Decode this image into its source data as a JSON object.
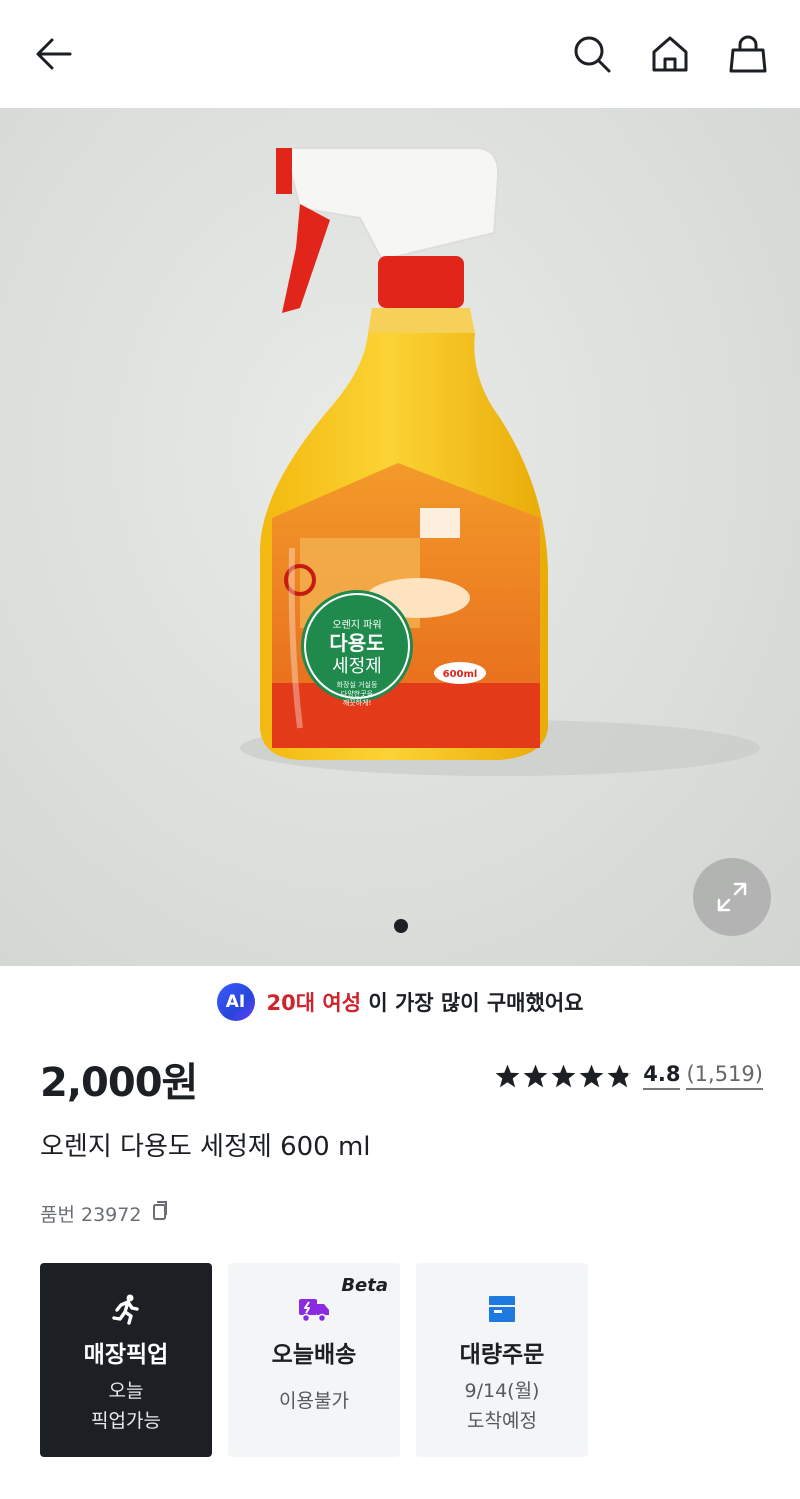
{
  "header": {
    "icons": [
      "arrow-left-icon",
      "search-icon",
      "home-icon",
      "shopping-bag-icon"
    ]
  },
  "gallery": {
    "label": {
      "line1": "오렌지 파워",
      "line2": "다용도",
      "line3": "세정제",
      "line4": "화장실 거실등",
      "line5": "다양한곳을",
      "line6": "깨끗하게!",
      "side": "600ml"
    },
    "colors": {
      "bottle": "#f6c21a",
      "cap": "#e1251b",
      "label_green": "#1f8a4c"
    }
  },
  "ai_banner": {
    "badge": "AI",
    "highlight": "20대 여성",
    "text": " 이 가장 많이 구매했어요"
  },
  "product": {
    "price": "2,000원",
    "rating": "4.8",
    "review_count": "(1,519)",
    "stars_level": 4.8,
    "name": "오렌지 다용도 세정제 600 ml",
    "item_no": "품번 23972"
  },
  "delivery_options": [
    {
      "title": "매장픽업",
      "sub1": "오늘",
      "sub2": "픽업가능",
      "icon": "running-person-icon"
    },
    {
      "title": "오늘배송",
      "sub1": "이용불가",
      "sub2": "",
      "badge": "Beta",
      "icon": "delivery-truck-icon"
    },
    {
      "title": "대량주문",
      "sub1": "9/14(월)",
      "sub2": "도착예정",
      "icon": "box-icon"
    }
  ]
}
